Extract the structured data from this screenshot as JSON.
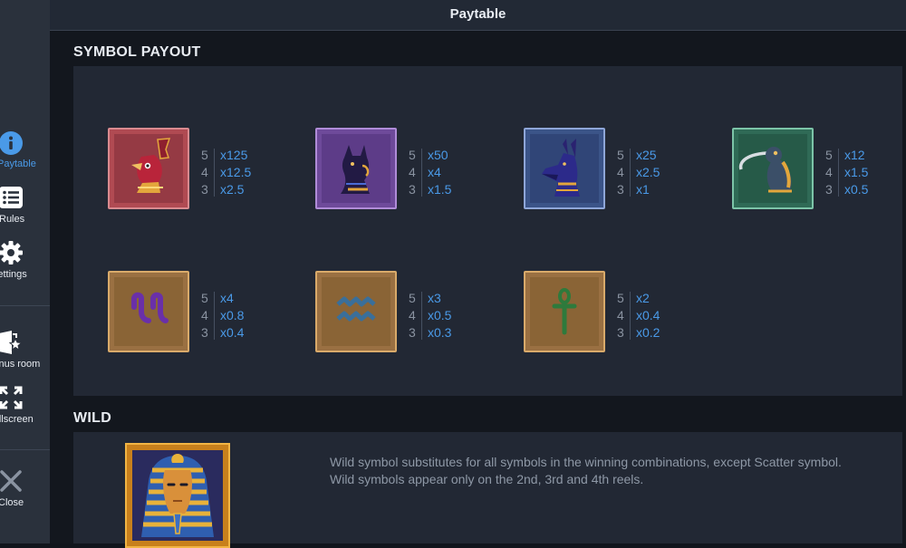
{
  "header": {
    "title": "Paytable"
  },
  "sidebar": {
    "items": [
      {
        "label": "Paytable",
        "icon": "info-icon",
        "active": true,
        "color": "#4a9ae8"
      },
      {
        "label": "Rules",
        "icon": "list-icon"
      },
      {
        "label": "Settings",
        "icon": "gear-icon"
      },
      {
        "label": "Bonus room",
        "icon": "bonus-room-icon"
      },
      {
        "label": "Fullscreen",
        "icon": "fullscreen-icon"
      },
      {
        "label": "Close",
        "icon": "close-icon"
      }
    ]
  },
  "symbol_payout": {
    "title": "SYMBOL PAYOUT",
    "symbols": [
      {
        "name": "horus",
        "frame": "red",
        "pays": [
          {
            "count": "5",
            "mult": "x125"
          },
          {
            "count": "4",
            "mult": "x12.5"
          },
          {
            "count": "3",
            "mult": "x2.5"
          }
        ]
      },
      {
        "name": "bastet",
        "frame": "purple",
        "pays": [
          {
            "count": "5",
            "mult": "x50"
          },
          {
            "count": "4",
            "mult": "x4"
          },
          {
            "count": "3",
            "mult": "x1.5"
          }
        ]
      },
      {
        "name": "anubis",
        "frame": "blue",
        "pays": [
          {
            "count": "5",
            "mult": "x25"
          },
          {
            "count": "4",
            "mult": "x2.5"
          },
          {
            "count": "3",
            "mult": "x1"
          }
        ]
      },
      {
        "name": "ibis",
        "frame": "green",
        "pays": [
          {
            "count": "5",
            "mult": "x12"
          },
          {
            "count": "4",
            "mult": "x1.5"
          },
          {
            "count": "3",
            "mult": "x0.5"
          }
        ]
      },
      {
        "name": "reeds-glyph",
        "frame": "sand",
        "pays": [
          {
            "count": "5",
            "mult": "x4"
          },
          {
            "count": "4",
            "mult": "x0.8"
          },
          {
            "count": "3",
            "mult": "x0.4"
          }
        ]
      },
      {
        "name": "water-glyph",
        "frame": "sand",
        "pays": [
          {
            "count": "5",
            "mult": "x3"
          },
          {
            "count": "4",
            "mult": "x0.5"
          },
          {
            "count": "3",
            "mult": "x0.3"
          }
        ]
      },
      {
        "name": "ankh-glyph",
        "frame": "sand",
        "pays": [
          {
            "count": "5",
            "mult": "x2"
          },
          {
            "count": "4",
            "mult": "x0.4"
          },
          {
            "count": "3",
            "mult": "x0.2"
          }
        ]
      }
    ]
  },
  "wild": {
    "title": "WILD",
    "symbol": "pharaoh",
    "description_line1": "Wild symbol substitutes for all symbols in the winning combinations, except Scatter symbol.",
    "description_line2": "Wild symbols appear only on the 2nd, 3rd and 4th reels."
  },
  "colors": {
    "accent": "#4a9ae8",
    "multiplier": "#4a9ae8",
    "count": "#8a93a1",
    "sidebar_bg": "#2a313c",
    "panel_bg": "#222834"
  }
}
